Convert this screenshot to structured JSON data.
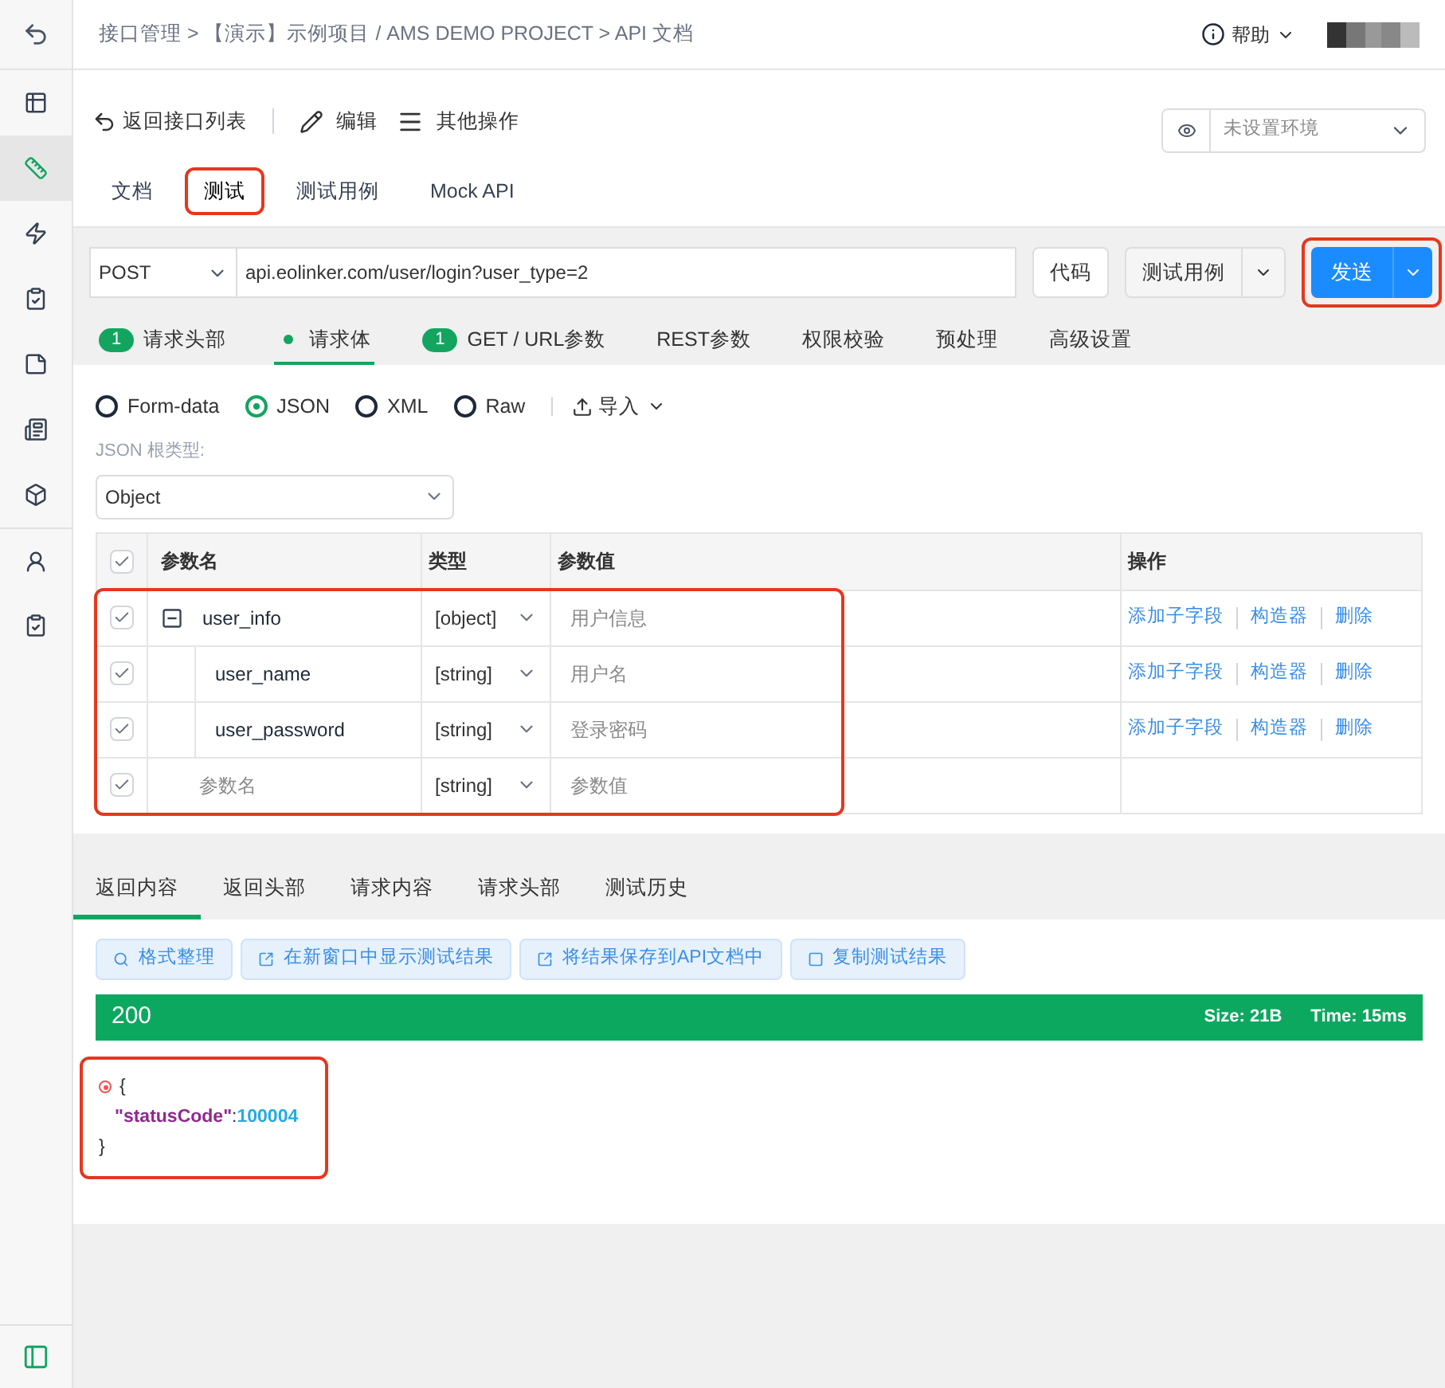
{
  "sidebar": {
    "back_selected": false,
    "items": [
      {
        "selected": false
      },
      {
        "selected": true
      },
      {
        "selected": false
      },
      {
        "selected": false
      },
      {
        "selected": false
      },
      {
        "selected": false
      },
      {
        "selected": false
      },
      {
        "selected": false
      },
      {
        "selected": false
      }
    ],
    "bottom_selected": true
  },
  "breadcrumb": "接口管理 > 【演示】示例项目 / AMS DEMO PROJECT > API 文档",
  "help": "帮助",
  "toolbar": [
    "返回接口列表",
    "编辑",
    "其他操作"
  ],
  "environment": {
    "placeholder": "未设置环境"
  },
  "doc_tabs": [
    {
      "label": "文档",
      "selected": false,
      "highlighted": false
    },
    {
      "label": "测试",
      "selected": true,
      "highlighted": true
    },
    {
      "label": "测试用例",
      "selected": false,
      "highlighted": false
    },
    {
      "label": "Mock API",
      "selected": false,
      "highlighted": false
    }
  ],
  "request": {
    "method": "POST",
    "url": "api.eolinker.com/user/login?user_type=2",
    "code_button": "代码",
    "case_button": "测试用例",
    "send_button": "发送",
    "send_highlighted": true
  },
  "request_tabs": [
    {
      "label": "请求头部",
      "badge": "1",
      "dot": false,
      "selected": false
    },
    {
      "label": "请求体",
      "dot": true,
      "selected": true
    },
    {
      "label": "GET / URL参数",
      "badge": "1",
      "dot": false,
      "selected": false
    },
    {
      "label": "REST参数",
      "dot": false,
      "selected": false
    },
    {
      "label": "权限校验",
      "dot": false,
      "selected": false
    },
    {
      "label": "预处理",
      "dot": false,
      "selected": false
    },
    {
      "label": "高级设置",
      "dot": false,
      "selected": false
    }
  ],
  "body_types": [
    {
      "label": "Form-data",
      "selected": false
    },
    {
      "label": "JSON",
      "selected": true
    },
    {
      "label": "XML",
      "selected": false
    },
    {
      "label": "Raw",
      "selected": false
    }
  ],
  "import_label": "导入",
  "root_type": {
    "label": "JSON 根类型:",
    "value": "Object"
  },
  "params": {
    "highlighted": true,
    "header_checked": true,
    "columns": [
      "参数名",
      "类型",
      "参数值",
      "操作"
    ],
    "rows": [
      {
        "checked": true,
        "name": "user_info",
        "type": "[object]",
        "value_placeholder": "用户信息",
        "actions": [
          "添加子字段",
          "构造器",
          "删除"
        ],
        "expanded": true,
        "children": [
          {
            "checked": true,
            "name": "user_name",
            "type": "[string]",
            "value_placeholder": "用户名",
            "actions": [
              "添加子字段",
              "构造器",
              "删除"
            ]
          },
          {
            "checked": true,
            "name": "user_password",
            "type": "[string]",
            "value_placeholder": "登录密码",
            "actions": [
              "添加子字段",
              "构造器",
              "删除"
            ]
          }
        ]
      },
      {
        "checked": true,
        "name_placeholder": "参数名",
        "type": "[string]",
        "value_placeholder": "参数值"
      }
    ]
  },
  "response_tabs": [
    {
      "label": "返回内容",
      "selected": true
    },
    {
      "label": "返回头部",
      "selected": false
    },
    {
      "label": "请求内容",
      "selected": false
    },
    {
      "label": "请求头部",
      "selected": false
    },
    {
      "label": "测试历史",
      "selected": false
    }
  ],
  "response_actions": [
    "格式整理",
    "在新窗口中显示测试结果",
    "将结果保存到API文档中",
    "复制测试结果"
  ],
  "status": {
    "code": "200",
    "size": "Size: 21B",
    "time": "Time: 15ms"
  },
  "response": {
    "highlighted": true,
    "open": "{",
    "key": "\"statusCode\"",
    "separator": ":",
    "value": "100004",
    "close": "}"
  }
}
